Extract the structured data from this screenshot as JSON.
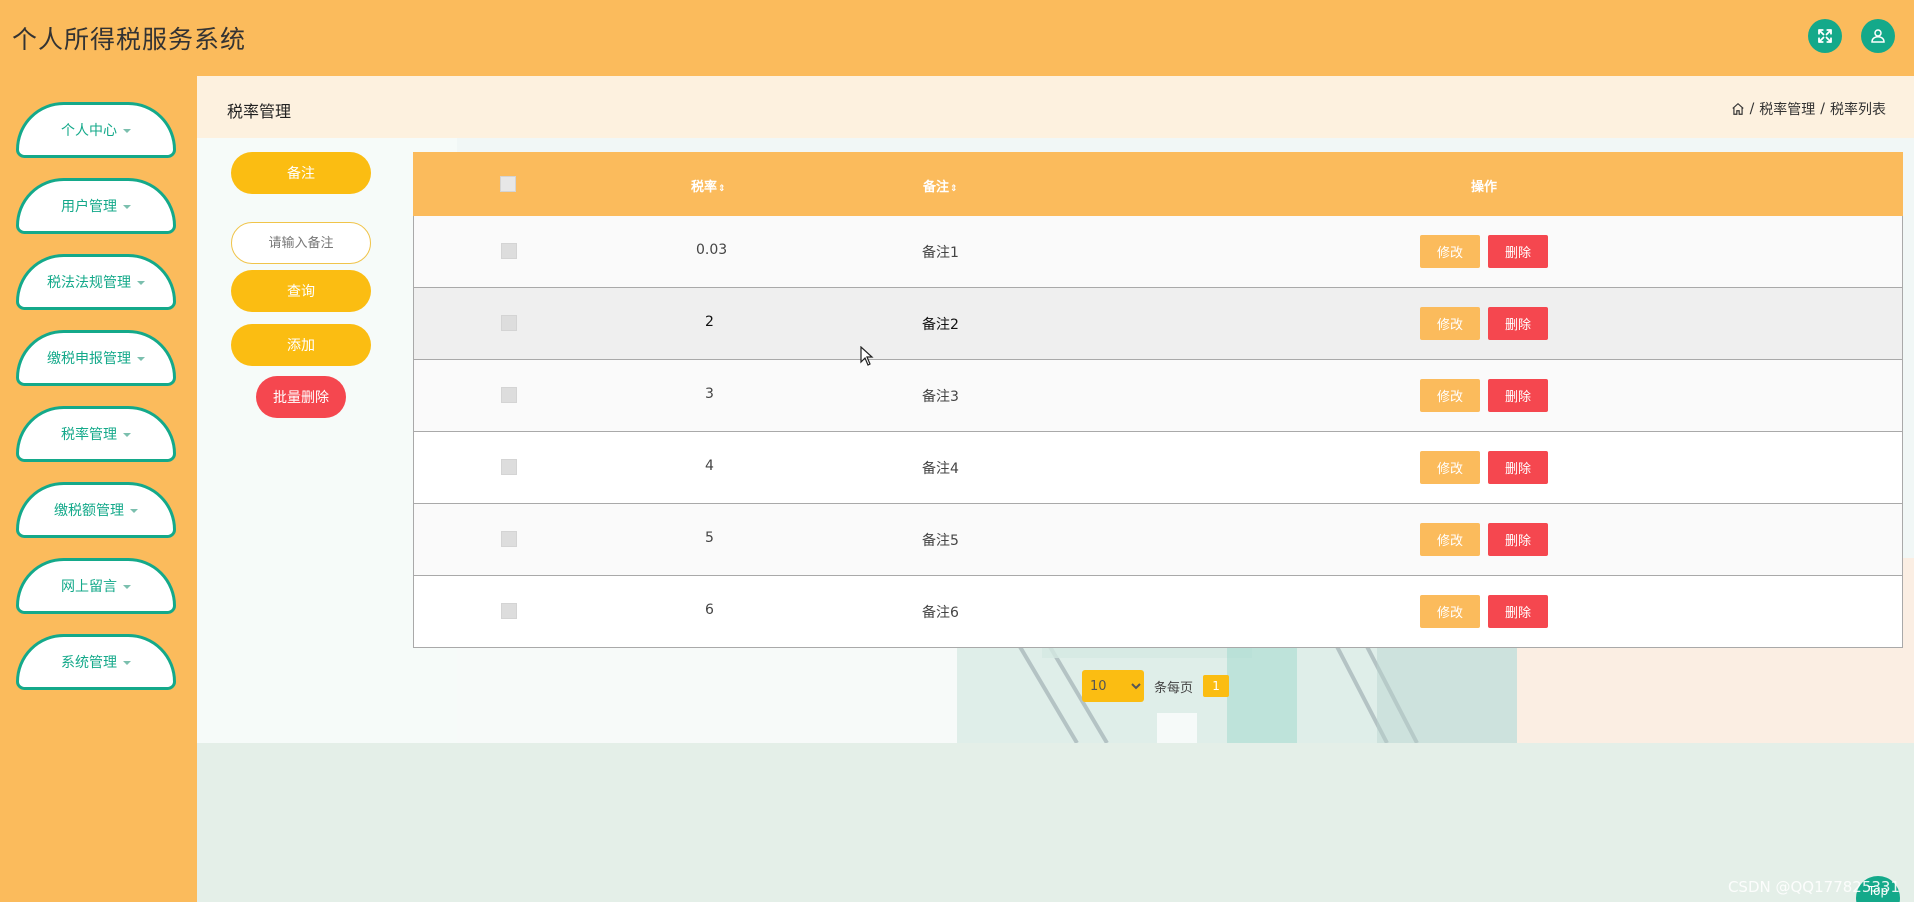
{
  "app": {
    "title": "个人所得税服务系统"
  },
  "header": {
    "fullscreen_icon": "expand-arrows-icon",
    "user_icon": "user-icon",
    "accent": "#14a98a",
    "bg": "#fbbb5c"
  },
  "sidebar": {
    "items": [
      {
        "label": "个人中心"
      },
      {
        "label": "用户管理"
      },
      {
        "label": "税法法规管理"
      },
      {
        "label": "缴税申报管理"
      },
      {
        "label": "税率管理"
      },
      {
        "label": "缴税额管理"
      },
      {
        "label": "网上留言"
      },
      {
        "label": "系统管理"
      }
    ]
  },
  "breadcrumb": {
    "title": "税率管理",
    "sep": "/",
    "level1": "税率管理",
    "level2": "税率列表"
  },
  "search": {
    "field_label": "备注",
    "placeholder": "请输入备注",
    "query_label": "查询",
    "add_label": "添加",
    "batch_delete_label": "批量删除"
  },
  "table": {
    "headers": {
      "rate": "税率",
      "note": "备注",
      "actions": "操作",
      "sort_icon": "⇕"
    },
    "rows": [
      {
        "rate": "0.03",
        "note": "备注1",
        "edit": "修改",
        "delete": "删除"
      },
      {
        "rate": "2",
        "note": "备注2",
        "edit": "修改",
        "delete": "删除"
      },
      {
        "rate": "3",
        "note": "备注3",
        "edit": "修改",
        "delete": "删除"
      },
      {
        "rate": "4",
        "note": "备注4",
        "edit": "修改",
        "delete": "删除"
      },
      {
        "rate": "5",
        "note": "备注5",
        "edit": "修改",
        "delete": "删除"
      },
      {
        "rate": "6",
        "note": "备注6",
        "edit": "修改",
        "delete": "删除"
      }
    ]
  },
  "pagination": {
    "page_size": "10",
    "per_page_label": "条每页",
    "current_page": "1"
  },
  "footer": {
    "watermark": "CSDN @QQ177825331",
    "top_label": "Top"
  }
}
